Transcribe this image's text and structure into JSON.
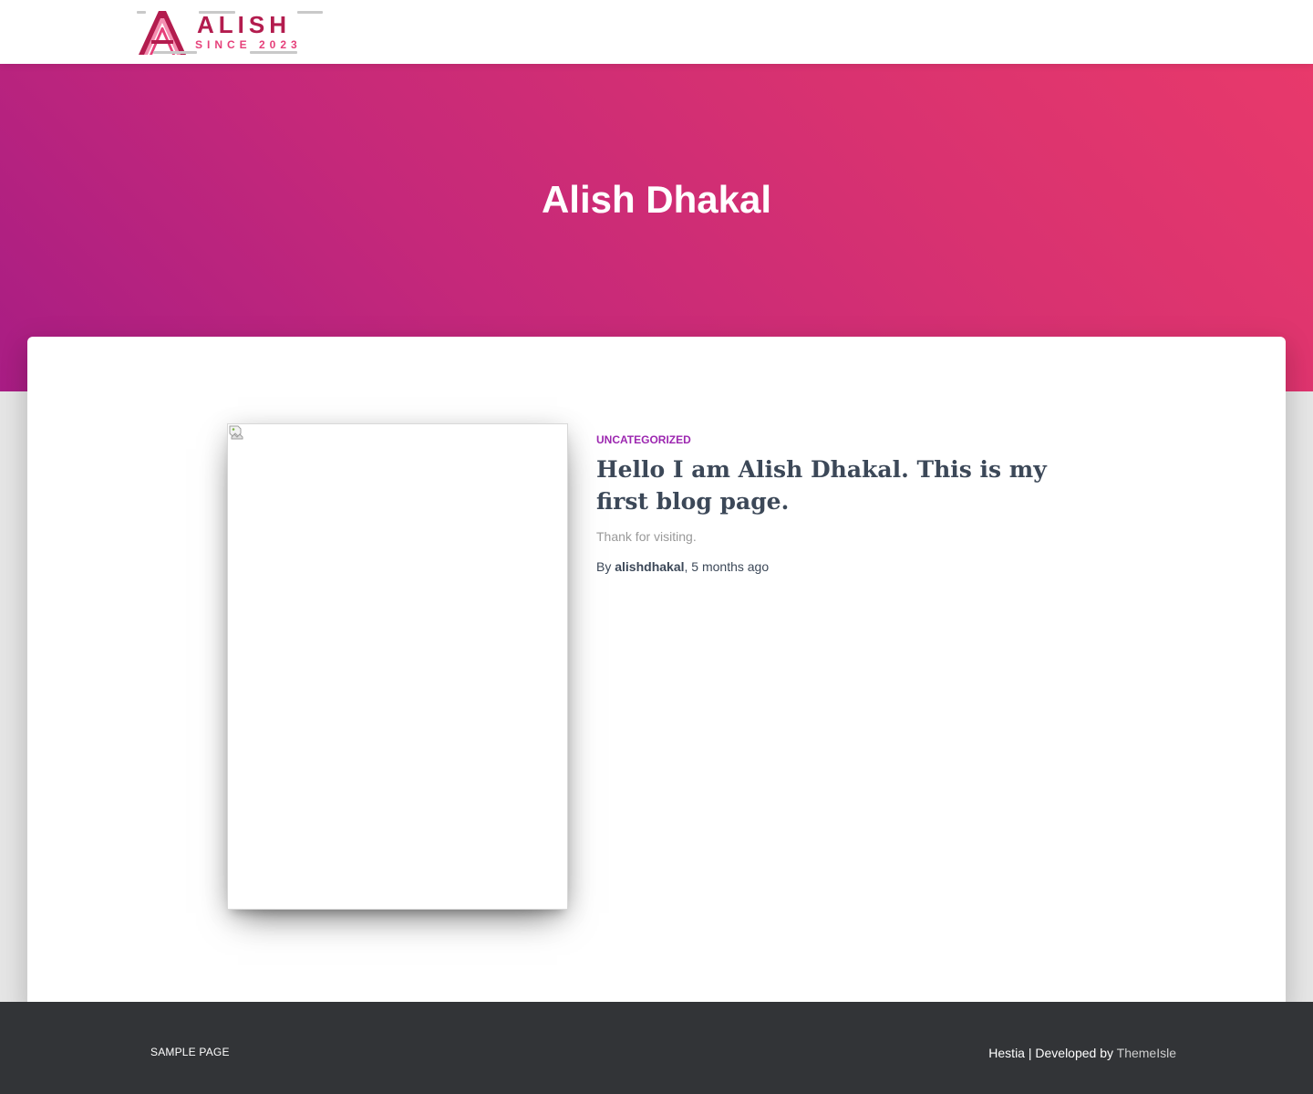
{
  "logo": {
    "word": "ALISH",
    "tagline": "SINCE 2023",
    "colors": {
      "dark": "#b31c4e",
      "light": "#e6407a",
      "pink": "#f48fb1"
    }
  },
  "hero": {
    "title": "Alish Dhakal",
    "gradient": [
      "#a81d84",
      "#e8396b"
    ]
  },
  "post": {
    "image_icon": "broken-image-icon",
    "category": "Uncategorized",
    "title": "Hello I am Alish Dhakal. This is my first blog page.",
    "excerpt": "Thank for visiting.",
    "by_label": "By",
    "author": "alishdhakal",
    "separator": ",",
    "date": "5 months ago",
    "category_color": "#9c27b0"
  },
  "footer": {
    "menu_item": "Sample Page",
    "credit_prefix": "Hestia | Developed by",
    "credit_link": "ThemeIsle"
  }
}
